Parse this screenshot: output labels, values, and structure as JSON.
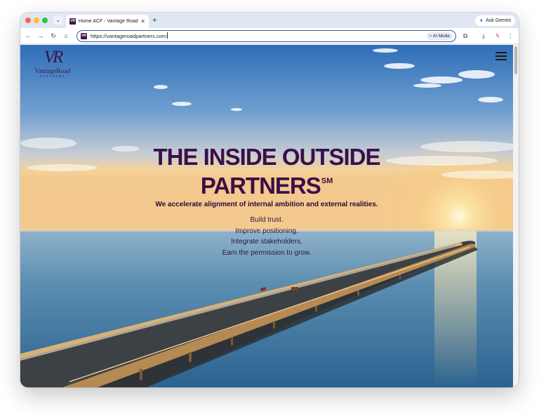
{
  "browser": {
    "tab": {
      "favicon_text": "VR",
      "title": "Home ACF - Vantage Road Pa",
      "close_glyph": "✕"
    },
    "new_tab_glyph": "+",
    "tab_menu_glyph": "⌄",
    "ask_gemini_label": "Ask Gemini",
    "gemini_glyph": "✦",
    "nav": {
      "back": "←",
      "forward": "→",
      "reload": "↻",
      "home": "⌂"
    },
    "address": {
      "url": "https://vantageroadpartners.com",
      "ai_mode_label": "AI Mode",
      "ai_mode_glyph": "⌕"
    },
    "toolbar_icons": {
      "extensions": "⧉",
      "download": "⤓",
      "pin": "ϟ",
      "menu": "⋮"
    }
  },
  "page": {
    "logo": {
      "mark": "VR",
      "name": "VantageRoad",
      "sub": "PARTNERS"
    },
    "headline_line1": "THE INSIDE OUTSIDE",
    "headline_line2": "PARTNERS",
    "service_mark": "SM",
    "tagline": "We accelerate alignment of internal ambition and external realities.",
    "points": [
      "Build trust.",
      "Improve positioning.",
      "Integrate stakeholders.",
      "Earn the permission to grow."
    ]
  },
  "colors": {
    "brand_purple": "#3b0f4a",
    "address_border": "#3b5ba8"
  },
  "icons": {
    "menu": "hamburger-menu-icon",
    "search": "search-icon"
  }
}
